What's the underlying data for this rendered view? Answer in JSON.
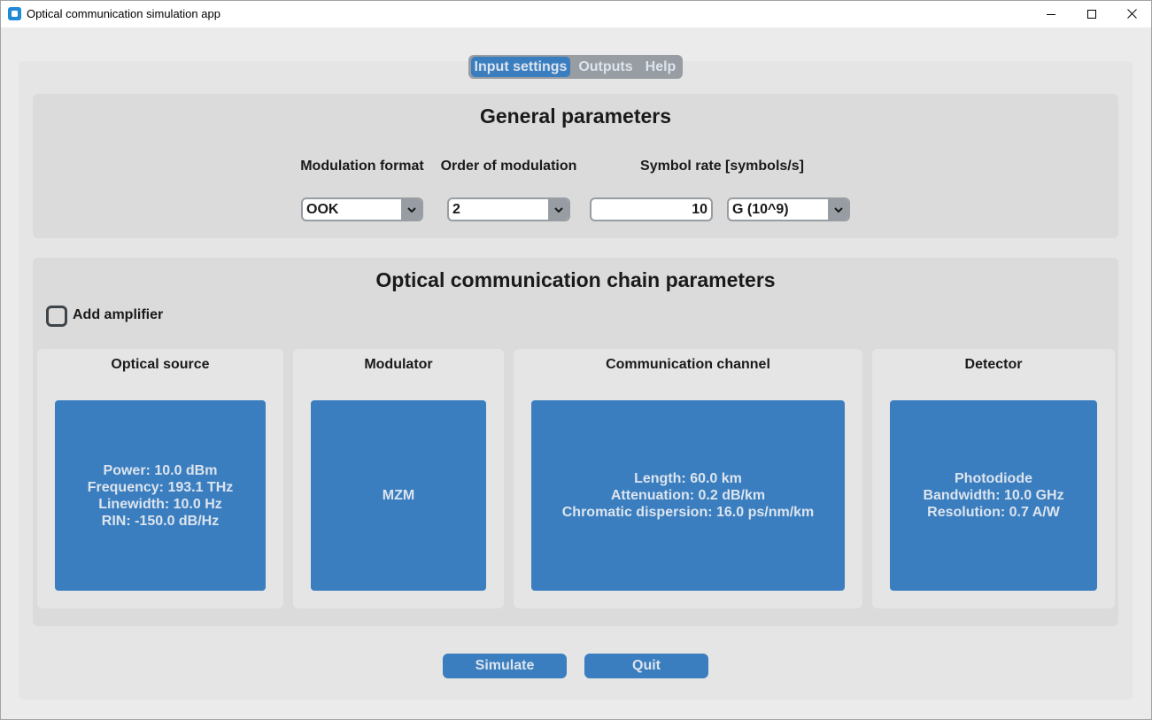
{
  "window": {
    "title": "Optical communication simulation app",
    "app_icon": "app-icon",
    "controls": {
      "minimize": "minimize-icon",
      "maximize": "maximize-icon",
      "close": "close-icon"
    }
  },
  "tabs": [
    {
      "label": "Input settings",
      "selected": true
    },
    {
      "label": "Outputs",
      "selected": false
    },
    {
      "label": "Help",
      "selected": false
    }
  ],
  "general": {
    "title": "General parameters",
    "modulation_format": {
      "label": "Modulation format",
      "value": "OOK"
    },
    "order_of_modulation": {
      "label": "Order of modulation",
      "value": "2"
    },
    "symbol_rate": {
      "label": "Symbol rate [symbols/s]",
      "value": "10",
      "unit": "G (10^9)"
    }
  },
  "chain": {
    "title": "Optical communication chain parameters",
    "add_amplifier": {
      "label": "Add amplifier",
      "checked": false
    },
    "blocks": [
      {
        "title": "Optical source",
        "lines": [
          "Power: 10.0 dBm",
          "Frequency: 193.1 THz",
          "Linewidth: 10.0 Hz",
          "RIN: -150.0 dB/Hz"
        ]
      },
      {
        "title": "Modulator",
        "lines": [
          "MZM"
        ]
      },
      {
        "title": "Communication channel",
        "lines": [
          "Length: 60.0 km",
          "Attenuation: 0.2 dB/km",
          "Chromatic dispersion: 16.0 ps/nm/km"
        ]
      },
      {
        "title": "Detector",
        "lines": [
          "Photodiode",
          "Bandwidth: 10.0 GHz",
          "Resolution: 0.7 A/W"
        ]
      }
    ]
  },
  "actions": {
    "simulate_label": "Simulate",
    "quit_label": "Quit"
  },
  "icons": {
    "dropdown": "chevron-down-icon",
    "checkbox": "checkbox-icon"
  },
  "colors": {
    "accent": "#3a7ebf",
    "segmented_unselected": "#979da2",
    "button_text": "#dce4ee",
    "window_bg": "#ebebeb",
    "tabview_bg": "#e5e5e5",
    "frame_bg": "#dbdbdb",
    "subframe_bg": "#e5e5e5",
    "text": "#1a1a1a",
    "checkbox_border": "#3e454a"
  }
}
